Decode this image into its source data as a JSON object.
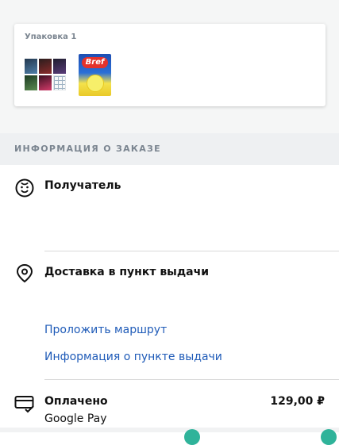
{
  "package": {
    "title": "Упаковка 1",
    "items": [
      {
        "name": "poster-set"
      },
      {
        "name": "Bref",
        "brand": "Bref"
      }
    ]
  },
  "section": {
    "title": "ИНФОРМАЦИЯ О ЗАКАЗЕ"
  },
  "recipient": {
    "heading": "Получатель",
    "icon": "face-smile-icon"
  },
  "delivery": {
    "heading": "Доставка в пункт выдачи",
    "icon": "map-pin-icon",
    "route_link": "Проложить маршрут",
    "info_link": "Информация о пункте выдачи"
  },
  "payment": {
    "heading": "Оплачено",
    "method": "Google Pay",
    "amount": "129,00 ₽",
    "icon": "card-check-icon"
  },
  "colors": {
    "link": "#1f5bb8",
    "section_bg": "#eef0f2",
    "accent": "#2fb39a"
  }
}
